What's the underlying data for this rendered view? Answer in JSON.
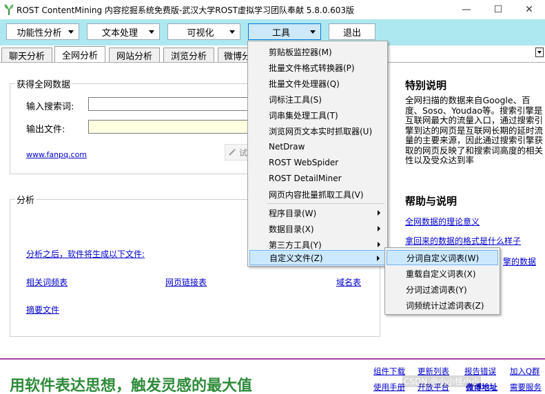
{
  "window": {
    "title": "ROST ContentMining 内容挖掘系统免费版-武汉大学ROST虚拟学习团队奉献  5.8.0.603版",
    "icons": {
      "app": "rost-logo-icon",
      "minimize": "minimize-icon",
      "maximize": "maximize-icon",
      "close": "close-icon"
    },
    "minimize_glyph": "—",
    "maximize_glyph": "☐",
    "close_glyph": "✕"
  },
  "toolbar": {
    "buttons": [
      {
        "label": "功能性分析"
      },
      {
        "label": "文本处理"
      },
      {
        "label": "可视化"
      },
      {
        "label": "工具"
      }
    ],
    "exit_label": "退出",
    "bg_color": "#ade8f0"
  },
  "tabs": [
    "聊天分析",
    "全网分析",
    "网站分析",
    "浏览分析",
    "微博分"
  ],
  "main": {
    "group1_title": "获得全网数据",
    "search_label": "输入搜索词:",
    "output_label": "输出文件:",
    "site_link": "www.fanpq.com",
    "button_partial": "试",
    "group2_title": "分析",
    "analysis_note": "分析之后，软件将生成以下文件:",
    "file_links": [
      "相关词频表",
      "网页链接表",
      "域名表",
      "摘要文件"
    ]
  },
  "side": {
    "special_title": "特别说明",
    "special_text": "全网扫描的数据来自Google、百度、Soso、Youdao等。搜索引擎是互联网最大的流量入口，通过搜索引擎到达的网页是互联网长期的延时流量的主要来源，因此通过搜索引擎获取的网页反映了和搜索词高度的相关性以及受众达到率",
    "help_title": "帮助与说明",
    "help_links": [
      "全网数据的理论意义",
      "拿回来的数据的格式是什么样子",
      "擎的数据"
    ]
  },
  "tools_menu": {
    "items": [
      {
        "label": "剪贴板监控器(M)"
      },
      {
        "label": "批量文件格式转换器(P)"
      },
      {
        "label": "批量文件处理器(Q)"
      },
      {
        "label": "词标注工具(S)"
      },
      {
        "label": "词串集处理工具(T)"
      },
      {
        "label": "浏览网页文本实时抓取器(U)"
      },
      {
        "label": "NetDraw"
      },
      {
        "label": "ROST WebSpider"
      },
      {
        "label": "ROST DetailMiner"
      },
      {
        "label": "网页内容批量抓取工具(V)"
      }
    ],
    "submenus": [
      {
        "label": "程序目录(W)"
      },
      {
        "label": "数据目录(X)"
      },
      {
        "label": "第三方工具(Y)"
      },
      {
        "label": "自定义文件(Z)"
      }
    ]
  },
  "custom_submenu": {
    "items": [
      "分词自定义词表(W)",
      "重载自定义词表(X)",
      "分词过滤词表(Y)",
      "词频统计过滤词表(Z)"
    ]
  },
  "footer": {
    "slogan": "用软件表达思想，触发灵感的最大值",
    "links_row1": [
      "组件下载",
      "更新列表",
      "报告错误",
      "加入Q群"
    ],
    "links_row2": [
      "使用手册",
      "开放平台",
      "微博地址",
      "需要服务"
    ],
    "watermark": "CSDN @小小怪小小"
  }
}
